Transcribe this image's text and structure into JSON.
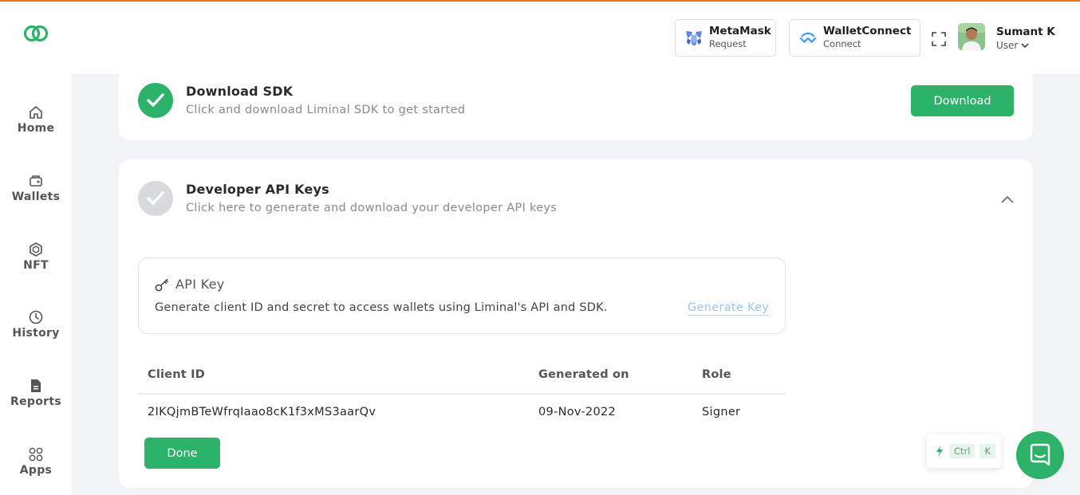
{
  "colors": {
    "accent": "#2cb369",
    "top_border": "#e8731a",
    "link": "#9cc2f0",
    "pending": "#d8dadd"
  },
  "header": {
    "metamask": {
      "name": "MetaMask",
      "sub": "Request",
      "icon": "metamask-fox-icon"
    },
    "walletconnect": {
      "name": "WalletConnect",
      "sub": "Connect",
      "icon": "walletconnect-icon"
    },
    "user": {
      "name": "Sumant K",
      "role": "User"
    }
  },
  "sidebar": {
    "items": [
      {
        "label": "Home",
        "icon": "home-icon"
      },
      {
        "label": "Wallets",
        "icon": "wallet-icon"
      },
      {
        "label": "NFT",
        "icon": "hexagon-icon"
      },
      {
        "label": "History",
        "icon": "clock-icon"
      },
      {
        "label": "Reports",
        "icon": "document-icon"
      },
      {
        "label": "Apps",
        "icon": "apps-grid-icon"
      }
    ]
  },
  "sdk_card": {
    "title": "Download SDK",
    "subtitle": "Click and download Liminal SDK to get started",
    "button": "Download",
    "completed": true
  },
  "api_card": {
    "title": "Developer API Keys",
    "subtitle": "Click here to generate and download your developer API keys",
    "expanded": true,
    "api_key_box": {
      "title": "API Key",
      "description": "Generate client ID and secret to access wallets using Liminal's API and SDK.",
      "link": "Generate Key"
    },
    "table": {
      "headers": [
        "Client ID",
        "Generated on",
        "Role"
      ],
      "rows": [
        [
          "2IKQjmBTeWfrqIaao8cK1f3xMS3aarQv",
          "09-Nov-2022",
          "Signer"
        ]
      ]
    },
    "done_button": "Done"
  },
  "shortcut": {
    "key1": "Ctrl",
    "key2": "K"
  }
}
